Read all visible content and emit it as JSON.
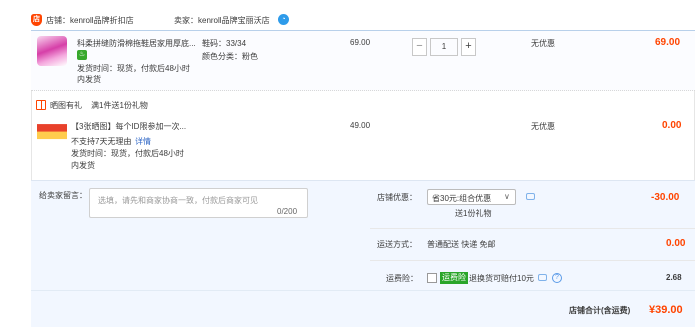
{
  "store": {
    "shop_icon": "shop-icon",
    "shop_label": "店铺：kenroll品牌折扣店",
    "seller_label": "卖家：kenroll品牌宝丽沃店",
    "ww_icon": "wangwang-icon"
  },
  "items": [
    {
      "title": "科柔拼缝防滑棉拖鞋居家用厚底...",
      "badge": "♨",
      "sku1": "鞋码：33/34",
      "sku2": "颜色分类：粉色",
      "ship_line1": "发货时间：现货，付款后48小时",
      "ship_line2": "内发货",
      "unit_price": "69.00",
      "quantity": "1",
      "minus": "−",
      "plus": "+",
      "discount": "无优惠",
      "subtotal": "69.00"
    },
    {
      "title": "【3张晒图】每个ID限参加一次...",
      "no_return": "不支持7天无理由",
      "detail_link": "详情",
      "ship_line1": "发货时间：现货，付款后48小时",
      "ship_line2": "内发货",
      "unit_price": "49.00",
      "discount": "无优惠",
      "subtotal": "0.00"
    }
  ],
  "gift": {
    "tag": "晒图有礼",
    "desc": "满1件送1份礼物"
  },
  "message": {
    "label": "给卖家留言：",
    "placeholder": "选填，请先和商家协商一致，付款后商家可见",
    "counter": "0/200"
  },
  "promo": {
    "label": "店铺优惠：",
    "selected": "省30元:组合优惠",
    "caret": "∨",
    "gift_note": "送1份礼物",
    "amount": "-30.00"
  },
  "shipping": {
    "label": "运送方式：",
    "value": "普通配送 快递 免邮",
    "amount": "0.00"
  },
  "insurance": {
    "label": "运费险：",
    "badge": "运费险",
    "desc": "退换货可赔付10元",
    "help": "?",
    "amount": "2.68"
  },
  "total": {
    "label": "店铺合计(含运费)",
    "amount": "¥39.00"
  }
}
